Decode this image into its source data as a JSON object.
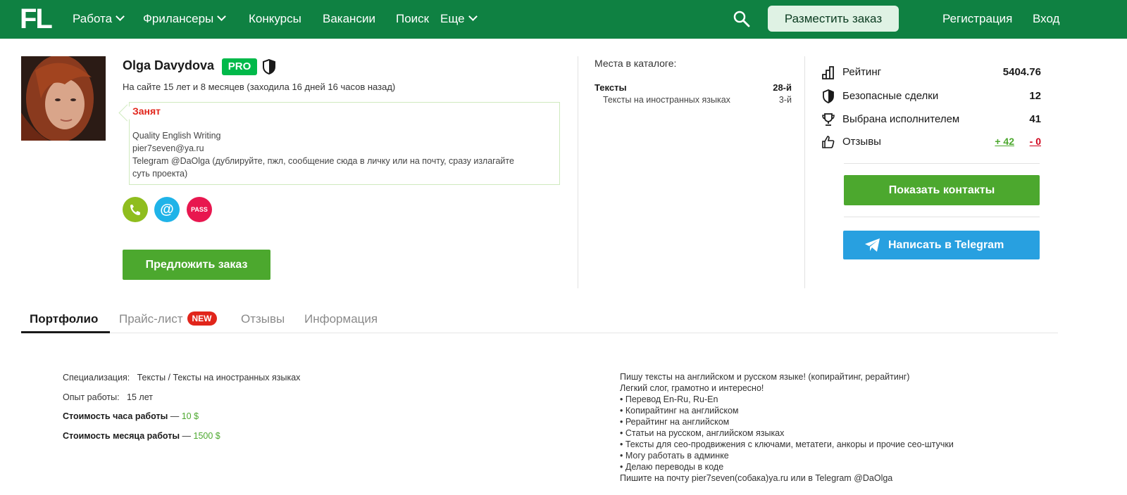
{
  "header": {
    "logo": "FL",
    "nav": [
      {
        "label": "Работа",
        "dropdown": true
      },
      {
        "label": "Фрилансеры",
        "dropdown": true
      },
      {
        "label": "Конкурсы",
        "dropdown": false
      },
      {
        "label": "Вакансии",
        "dropdown": false
      },
      {
        "label": "Поиск",
        "dropdown": false
      },
      {
        "label": "Еще",
        "dropdown": true
      }
    ],
    "place_order": "Разместить заказ",
    "register": "Регистрация",
    "login": "Вход"
  },
  "profile": {
    "name": "Olga Davydova",
    "pro_badge": "PRO",
    "since": "На сайте 15 лет и 8 месяцев (заходила 16 дней 16 часов назад)",
    "status": "Занят",
    "status_lines": [
      "Quality English Writing",
      "pier7seven@ya.ru",
      "Telegram @DaOlga (дублируйте, пжл, сообщение сюда в личку или на почту, сразу излагайте",
      "суть проекта)"
    ],
    "contact_icons": [
      {
        "icon": "phone-icon",
        "label": "",
        "color": "#8fbd1e"
      },
      {
        "icon": "email-icon",
        "label": "@",
        "color": "#1fb3e8"
      },
      {
        "icon": "passport-icon",
        "label": "PASS",
        "color": "#e8174f"
      }
    ],
    "offer_button": "Предложить заказ"
  },
  "catalog": {
    "title": "Места в каталоге:",
    "main": {
      "name": "Тексты",
      "place": "28-й"
    },
    "sub": {
      "name": "Тексты на иностранных языках",
      "place": "3-й"
    }
  },
  "stats": {
    "rating_label": "Рейтинг",
    "rating_value": "5404.76",
    "safe_deals_label": "Безопасные сделки",
    "safe_deals_value": "12",
    "chosen_label": "Выбрана исполнителем",
    "chosen_value": "41",
    "reviews_label": "Отзывы",
    "reviews_positive": "+ 42",
    "reviews_negative": "- 0"
  },
  "buttons": {
    "show_contacts": "Показать контакты",
    "telegram": "Написать в Telegram"
  },
  "tabs": {
    "portfolio": "Портфолио",
    "pricelist": "Прайс-лист",
    "new_badge": "NEW",
    "reviews": "Отзывы",
    "info": "Информация"
  },
  "info": {
    "spec_label": "Специализация:",
    "spec_value": "Тексты / Тексты на иностранных языках",
    "exp_label": "Опыт работы:",
    "exp_value": "15 лет",
    "hour_label": "Стоимость часа работы",
    "hour_value": "10 $",
    "month_label": "Стоимость месяца работы",
    "month_value": "1500 $",
    "dash": " — "
  },
  "description": [
    "Пишу тексты на английском и русском языке! (копирайтинг, рерайтинг)",
    "Легкий слог, грамотно и интересно!",
    "• Перевод En-Ru, Ru-En",
    "• Копирайтинг на английском",
    "• Рерайтинг на английском",
    "• Статьи на русском, английском языках",
    "• Тексты для сео-продвижения с ключами, метатеги, анкоры и прочие сео-штучки",
    "• Могу работать в админке",
    "• Делаю переводы в коде",
    "Пишите на почту pier7seven(собака)ya.ru или в Telegram @DaOlga"
  ],
  "colors": {
    "header_bg": "#0f8142",
    "accent_green": "#4ca82e",
    "telegram_blue": "#28a0e0",
    "pro_green": "#00b94a",
    "busy_red": "#e1251b"
  }
}
